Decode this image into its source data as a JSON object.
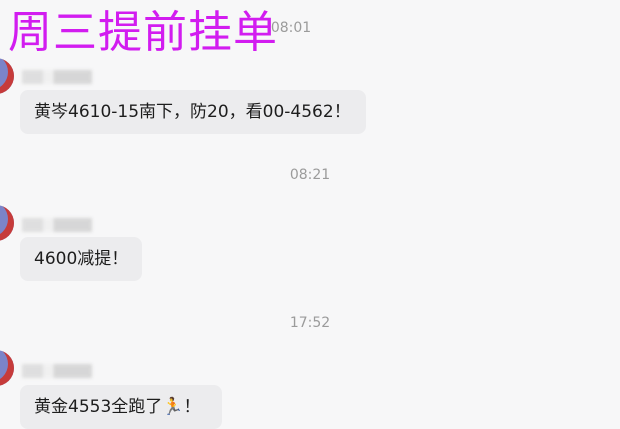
{
  "overlay": {
    "title": "周三提前挂单"
  },
  "messages": [
    {
      "time": "08:01",
      "text": "黄岑4610-15南下，防20，看00-4562！"
    },
    {
      "time": "08:21",
      "text": "4600减提！"
    },
    {
      "time": "17:52",
      "text": "黄金4553全跑了",
      "emoji": "🏃",
      "suffix": "！"
    }
  ]
}
